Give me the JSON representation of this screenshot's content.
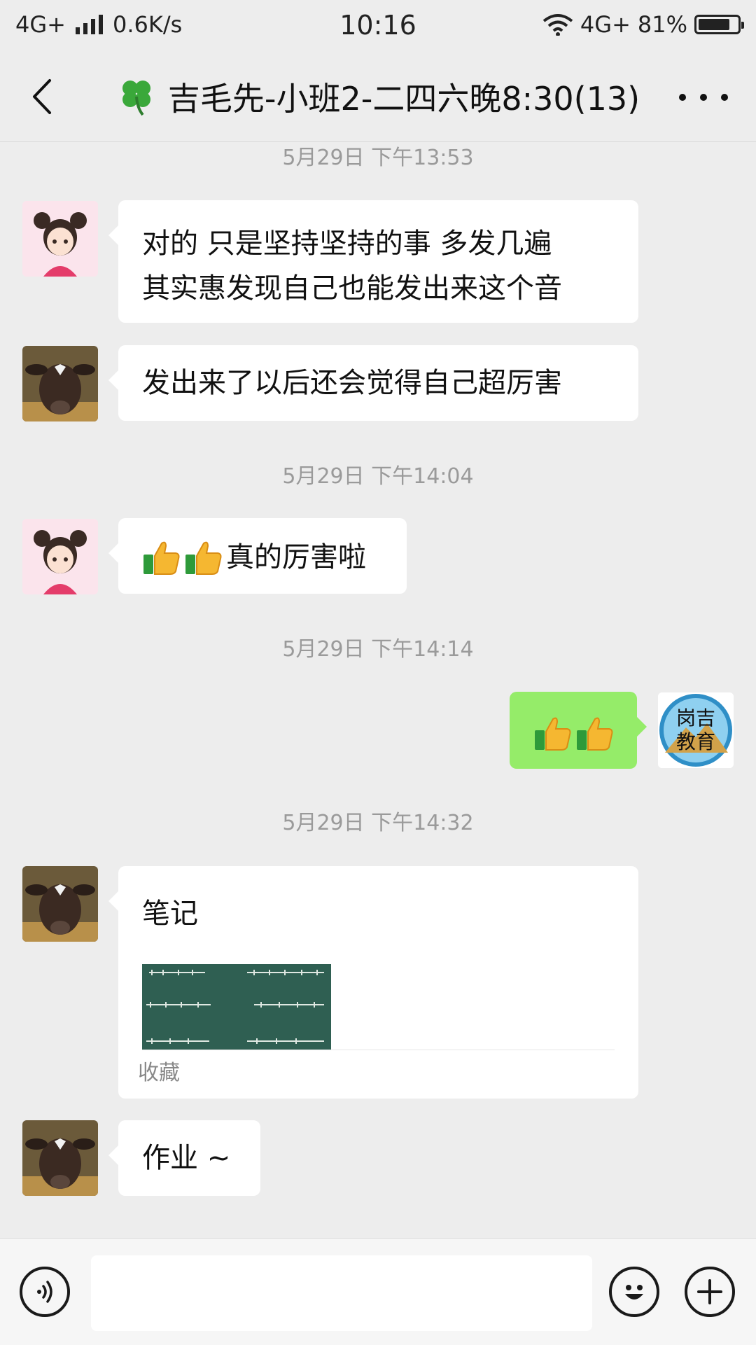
{
  "status_bar": {
    "network": "4G+",
    "speed": "0.6K/s",
    "time": "10:16",
    "network_right": "4G+",
    "battery_percent": "81%",
    "battery_level": 0.81
  },
  "header": {
    "title": "吉毛先-小班2-二四六晚8:30(13)",
    "title_icon": "four-leaf-clover-emoji"
  },
  "messages": [
    {
      "type": "timestamp",
      "text": "5月29日 下午13:53"
    },
    {
      "type": "text",
      "side": "left",
      "avatar": "girl-avatar",
      "lines": [
        "对的  只是坚持坚持的事  多发几遍",
        "其实惠发现自己也能发出来这个音"
      ]
    },
    {
      "type": "text",
      "side": "left",
      "avatar": "calf-avatar",
      "text": "发出来了以后还会觉得自己超厉害"
    },
    {
      "type": "timestamp",
      "text": "5月29日 下午14:04"
    },
    {
      "type": "text",
      "side": "left",
      "avatar": "girl-avatar",
      "emoji": [
        "thumbs-up",
        "thumbs-up"
      ],
      "text": "真的厉害啦"
    },
    {
      "type": "timestamp",
      "text": "5月29日 下午14:14"
    },
    {
      "type": "emoji",
      "side": "right",
      "avatar": "gangji-logo",
      "emoji": [
        "thumbs-up",
        "thumbs-up"
      ],
      "avatar_text": [
        "岗吉",
        "教育"
      ]
    },
    {
      "type": "timestamp",
      "text": "5月29日 下午14:32"
    },
    {
      "type": "card",
      "side": "left",
      "avatar": "calf-avatar",
      "title": "笔记",
      "source": "收藏",
      "image": "tibetan-script-blackboard-thumbnail"
    },
    {
      "type": "text",
      "side": "left",
      "avatar": "calf-avatar",
      "text": "作业 ~"
    }
  ],
  "input_bar": {
    "voice_icon": "voice-icon",
    "emoji_icon": "emoji-icon",
    "plus_icon": "plus-icon",
    "value": ""
  },
  "colors": {
    "background": "#ededed",
    "bubble_left": "#ffffff",
    "bubble_right": "#95ec69",
    "timestamp": "#9a9a9a"
  }
}
